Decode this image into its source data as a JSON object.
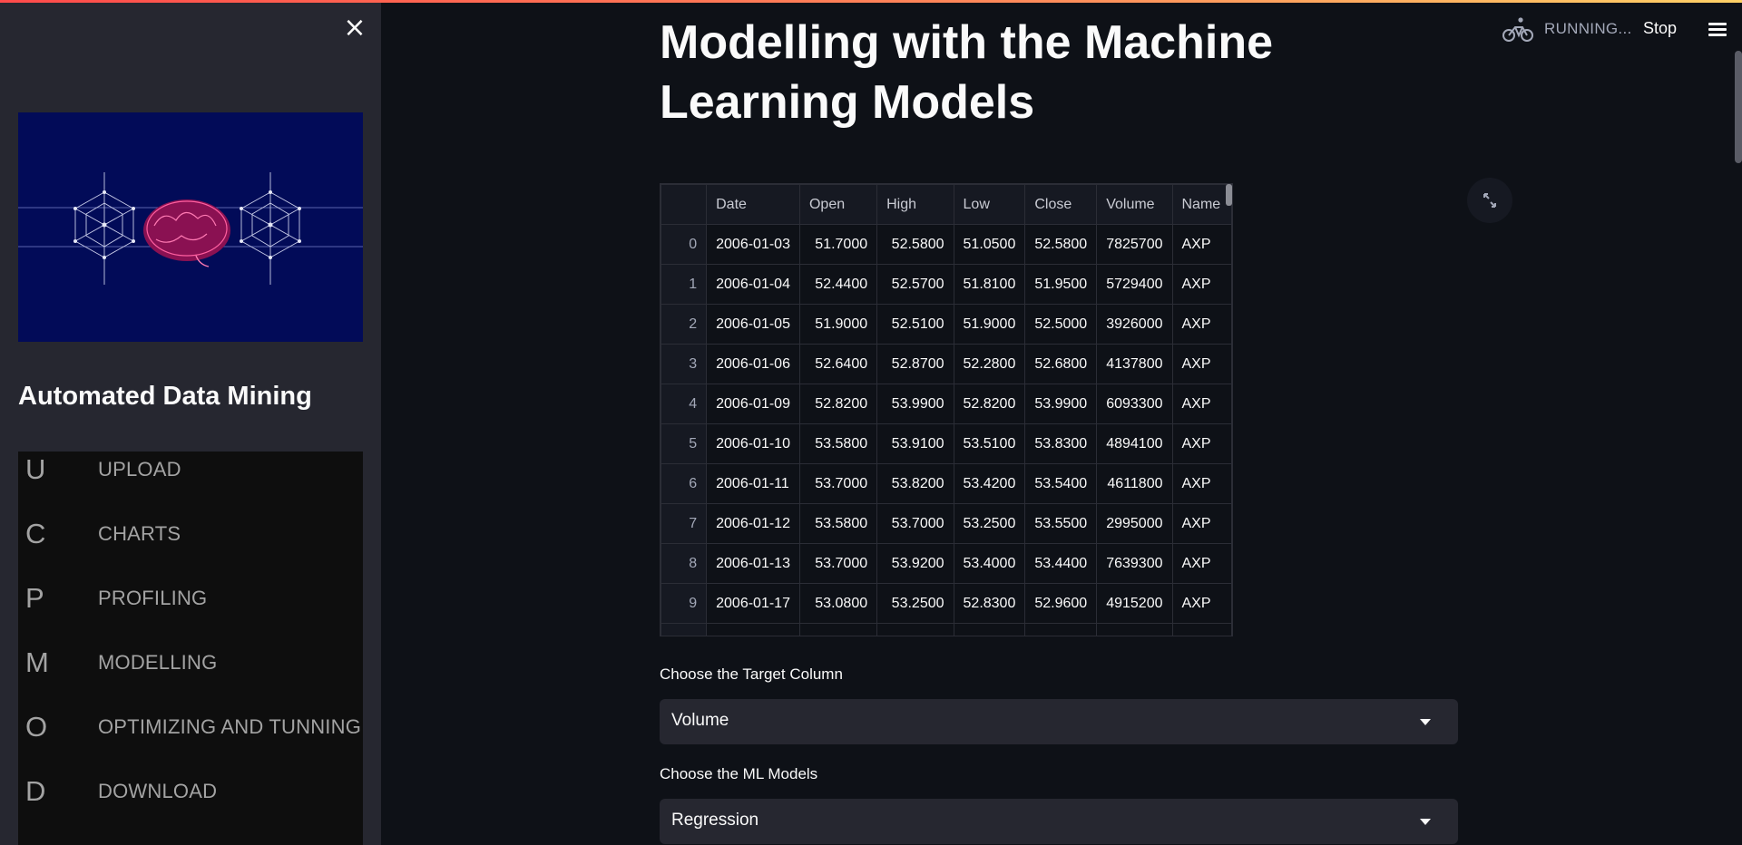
{
  "header": {
    "status_text": "RUNNING...",
    "stop_label": "Stop",
    "running_icon": "bicycle-icon",
    "menu_icon": "hamburger-menu-icon"
  },
  "sidebar": {
    "close_icon": "close-icon",
    "title": "Automated Data Mining",
    "banner_icon": "brain-network-illustration",
    "nav_items": [
      {
        "icon": "U",
        "label": "UPLOAD"
      },
      {
        "icon": "C",
        "label": "CHARTS"
      },
      {
        "icon": "P",
        "label": "PROFILING"
      },
      {
        "icon": "M",
        "label": "MODELLING"
      },
      {
        "icon": "O",
        "label": "OPTIMIZING AND TUNNING"
      },
      {
        "icon": "D",
        "label": "DOWNLOAD"
      }
    ]
  },
  "main": {
    "title_line1": "Modelling with the Machine",
    "title_line2": "Learning Models",
    "table": {
      "columns": [
        "",
        "Date",
        "Open",
        "High",
        "Low",
        "Close",
        "Volume",
        "Name"
      ],
      "rows": [
        [
          "0",
          "2006-01-03",
          "51.7000",
          "52.5800",
          "51.0500",
          "52.5800",
          "7825700",
          "AXP"
        ],
        [
          "1",
          "2006-01-04",
          "52.4400",
          "52.5700",
          "51.8100",
          "51.9500",
          "5729400",
          "AXP"
        ],
        [
          "2",
          "2006-01-05",
          "51.9000",
          "52.5100",
          "51.9000",
          "52.5000",
          "3926000",
          "AXP"
        ],
        [
          "3",
          "2006-01-06",
          "52.6400",
          "52.8700",
          "52.2800",
          "52.6800",
          "4137800",
          "AXP"
        ],
        [
          "4",
          "2006-01-09",
          "52.8200",
          "53.9900",
          "52.8200",
          "53.9900",
          "6093300",
          "AXP"
        ],
        [
          "5",
          "2006-01-10",
          "53.5800",
          "53.9100",
          "53.5100",
          "53.8300",
          "4894100",
          "AXP"
        ],
        [
          "6",
          "2006-01-11",
          "53.7000",
          "53.8200",
          "53.4200",
          "53.5400",
          "4611800",
          "AXP"
        ],
        [
          "7",
          "2006-01-12",
          "53.5800",
          "53.7000",
          "53.2500",
          "53.5500",
          "2995000",
          "AXP"
        ],
        [
          "8",
          "2006-01-13",
          "53.7000",
          "53.9200",
          "53.4000",
          "53.4400",
          "7639300",
          "AXP"
        ],
        [
          "9",
          "2006-01-17",
          "53.0800",
          "53.2500",
          "52.8300",
          "52.9600",
          "4915200",
          "AXP"
        ],
        [
          "",
          "",
          "",
          "",
          "",
          "",
          "",
          ""
        ]
      ]
    },
    "expand_icon": "expand-icon",
    "target_label": "Choose the Target Column",
    "target_value": "Volume",
    "models_label": "Choose the ML Models",
    "models_value": "Regression"
  }
}
